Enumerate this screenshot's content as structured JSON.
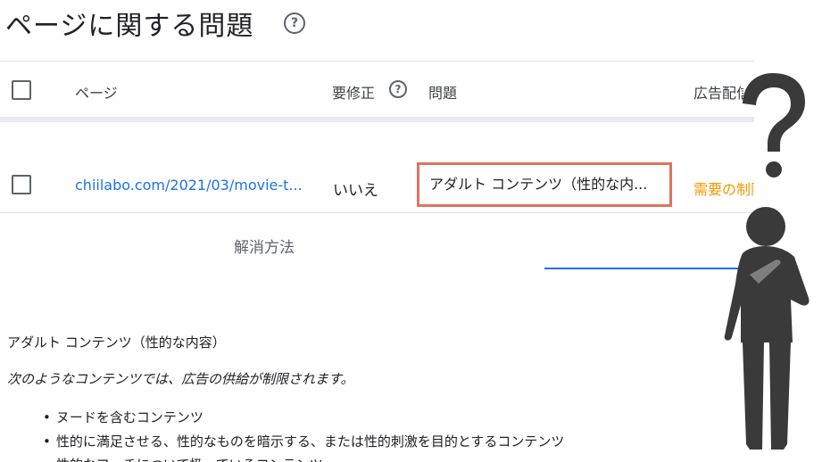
{
  "header": {
    "title": "ページに関する問題",
    "help_icon": "help-circle-icon",
    "help_glyph": "?"
  },
  "table": {
    "columns": {
      "page": "ページ",
      "needs_fix": "要修正",
      "needs_fix_help_glyph": "?",
      "issue": "問題",
      "ad_serving": "広告配信"
    },
    "rows": [
      {
        "url": "chiilabo.com/2021/03/movie-t...",
        "needs_fix": "いいえ",
        "issue": "アダルト コンテンツ（性的な内...",
        "ad_serving": "需要の制限"
      }
    ]
  },
  "resolve": {
    "label": "解消方法"
  },
  "detail": {
    "heading": "アダルト コンテンツ（性的な内容）",
    "note": "次のようなコンテンツでは、広告の供給が制限されます。",
    "bullets": [
      "ヌードを含むコンテンツ",
      "性的に満足させる、性的なものを暗示する、または性的刺激を目的とするコンテンツ",
      "性的なフェチについて扱っているコンテンツ"
    ]
  },
  "illustration": {
    "icon": "confused-person-question-mark-icon",
    "color": "#3a3a3a"
  },
  "colors": {
    "link": "#1a73e8",
    "warning": "#f29900",
    "highlight_border": "#e0735d"
  }
}
